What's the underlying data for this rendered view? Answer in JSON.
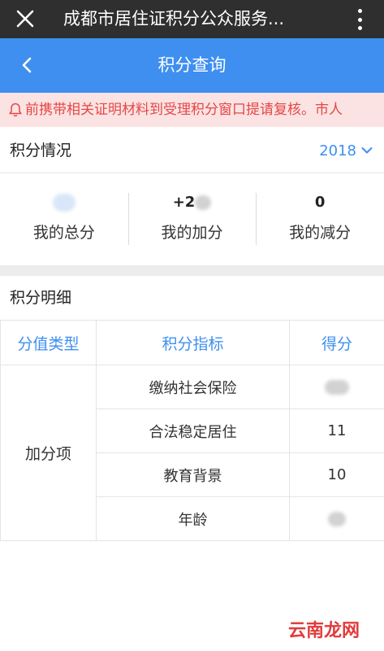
{
  "topbar": {
    "title": "成都市居住证积分公众服务...",
    "close_icon": "close-icon",
    "more_icon": "more-vertical-icon"
  },
  "navbar": {
    "title": "积分查询",
    "back_icon": "chevron-left-icon"
  },
  "notice": {
    "text": "前携带相关证明材料到受理积分窗口提请复核。市人",
    "icon": "bell-icon",
    "color": "#e64646"
  },
  "summary": {
    "heading": "积分情况",
    "year": "2018",
    "stats": [
      {
        "value": "",
        "label": "我的总分"
      },
      {
        "value": "+2",
        "label": "我的加分"
      },
      {
        "value": "0",
        "label": "我的减分"
      }
    ]
  },
  "detail": {
    "heading": "积分明细",
    "columns": [
      "分值类型",
      "积分指标",
      "得分"
    ],
    "category": "加分项",
    "rows": [
      {
        "indicator": "缴纳社会保险",
        "score": ""
      },
      {
        "indicator": "合法稳定居住",
        "score": "11"
      },
      {
        "indicator": "教育背景",
        "score": "10"
      },
      {
        "indicator": "年龄",
        "score": ""
      }
    ]
  },
  "watermark": "云南龙网",
  "colors": {
    "accent": "#3e8ff0",
    "topbar": "#2f2f2f",
    "notice_bg": "#fbe3e3"
  }
}
